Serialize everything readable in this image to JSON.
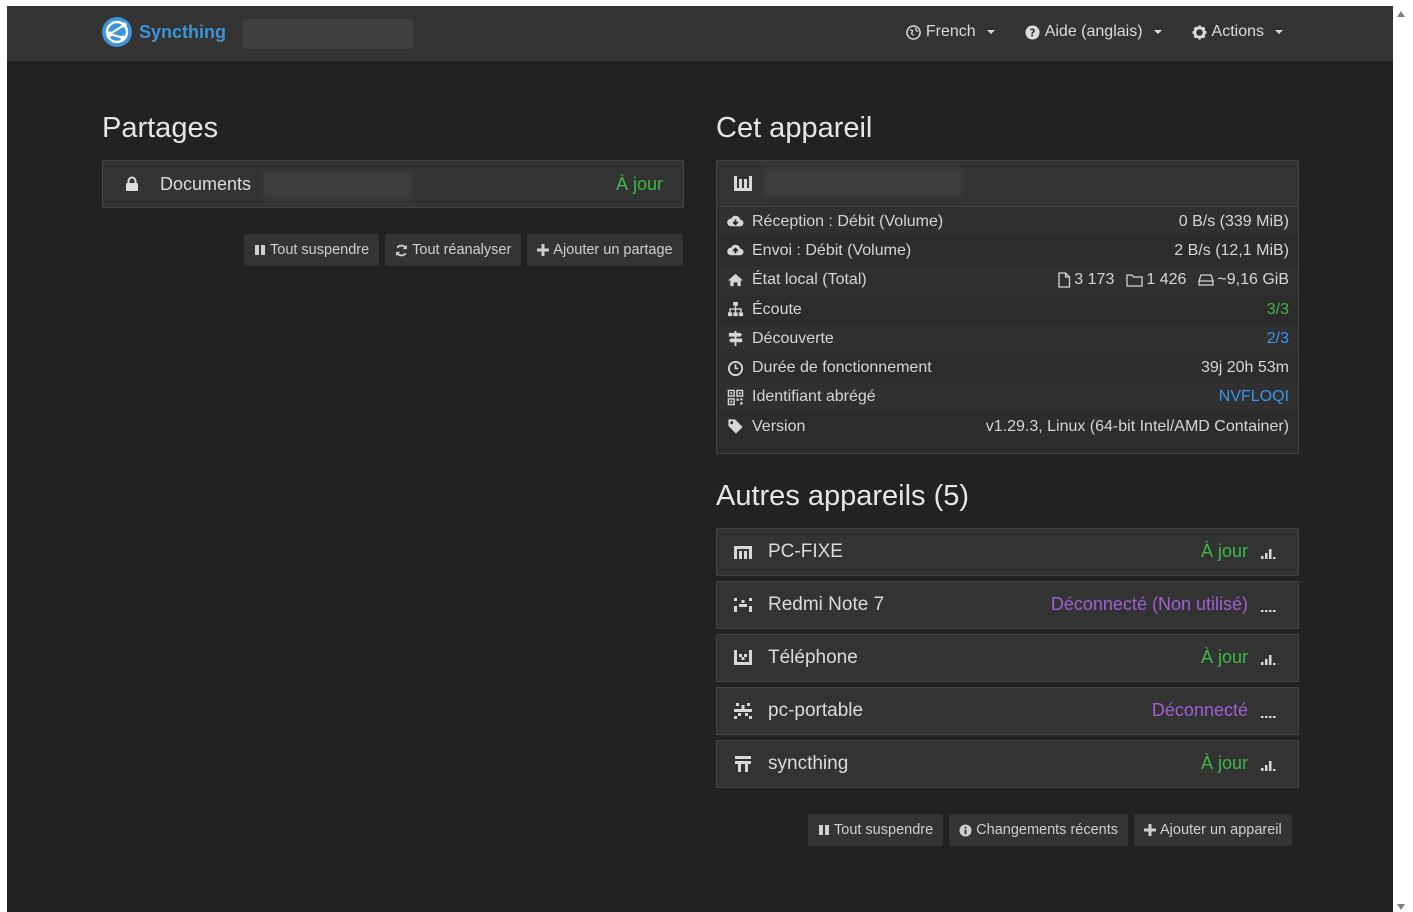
{
  "navbar": {
    "brand": "Syncthing",
    "language": "French",
    "help": "Aide (anglais)",
    "actions": "Actions"
  },
  "folders": {
    "heading": "Partages",
    "items": [
      {
        "name": "Documents",
        "status": "À jour"
      }
    ],
    "buttons": {
      "pause_all": "Tout suspendre",
      "rescan_all": "Tout réanalyser",
      "add_folder": "Ajouter un partage"
    }
  },
  "this_device": {
    "heading": "Cet appareil",
    "rows": [
      {
        "icon": "cloud-download-icon",
        "label": "Réception : Débit (Volume)",
        "value": "0 B/s (339 MiB)"
      },
      {
        "icon": "cloud-upload-icon",
        "label": "Envoi : Débit (Volume)",
        "value": "2 B/s (12,1 MiB)"
      },
      {
        "icon": "home-icon",
        "label": "État local (Total)",
        "files": "3 173",
        "dirs": "1 426",
        "size": "~9,16 GiB"
      },
      {
        "icon": "sitemap-icon",
        "label": "Écoute",
        "value": "3/3"
      },
      {
        "icon": "signpost-icon",
        "label": "Découverte",
        "value": "2/3"
      },
      {
        "icon": "clock-icon",
        "label": "Durée de fonctionnement",
        "value": "39j 20h 53m"
      },
      {
        "icon": "qrcode-icon",
        "label": "Identifiant abrégé",
        "value": "NVFLOQI"
      },
      {
        "icon": "tag-icon",
        "label": "Version",
        "value": "v1.29.3, Linux (64-bit Intel/AMD Container)"
      }
    ]
  },
  "remote_devices": {
    "heading": "Autres appareils (5)",
    "items": [
      {
        "name": "PC-FIXE",
        "status": "À jour",
        "state": "connected"
      },
      {
        "name": "Redmi Note 7",
        "status": "Déconnecté (Non utilisé)",
        "state": "disconnected"
      },
      {
        "name": "Téléphone",
        "status": "À jour",
        "state": "connected"
      },
      {
        "name": "pc-portable",
        "status": "Déconnecté",
        "state": "disconnected"
      },
      {
        "name": "syncthing",
        "status": "À jour",
        "state": "connected"
      }
    ],
    "buttons": {
      "pause_all": "Tout suspendre",
      "recent_changes": "Changements récents",
      "add_device": "Ajouter un appareil"
    }
  },
  "colors": {
    "in_sync": "#3fb947",
    "disconnected": "#a15fd6",
    "link": "#3c95f0",
    "brand": "#3c95d6"
  }
}
